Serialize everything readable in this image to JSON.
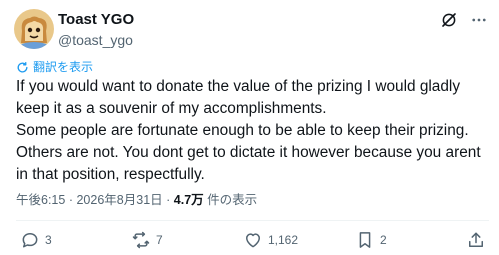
{
  "author": {
    "name": "Toast YGO",
    "handle": "@toast_ygo",
    "avatar_icon": "toast-mascot-avatar"
  },
  "header_icons": [
    "grok-icon",
    "more-icon"
  ],
  "translate_label": "翻訳を表示",
  "post": {
    "paragraphs": [
      "If you would want to donate the value of the prizing I would gladly keep it as a souvenir of my accomplishments.",
      "Some people are fortunate enough to be able to keep their prizing. Others are not. You dont get to dictate it however because you arent in that position, respectfully."
    ]
  },
  "meta": {
    "time": "午後6:15",
    "separator": "·",
    "date": "2026年8月31日",
    "views": "4.7万",
    "views_label": "件の表示"
  },
  "actions": {
    "reply_count": "3",
    "repost_count": "7",
    "like_count": "1,162",
    "bookmark_count": "2"
  },
  "colors": {
    "text": "#0f1419",
    "secondary": "#536471",
    "accent": "#1d9bf0"
  }
}
